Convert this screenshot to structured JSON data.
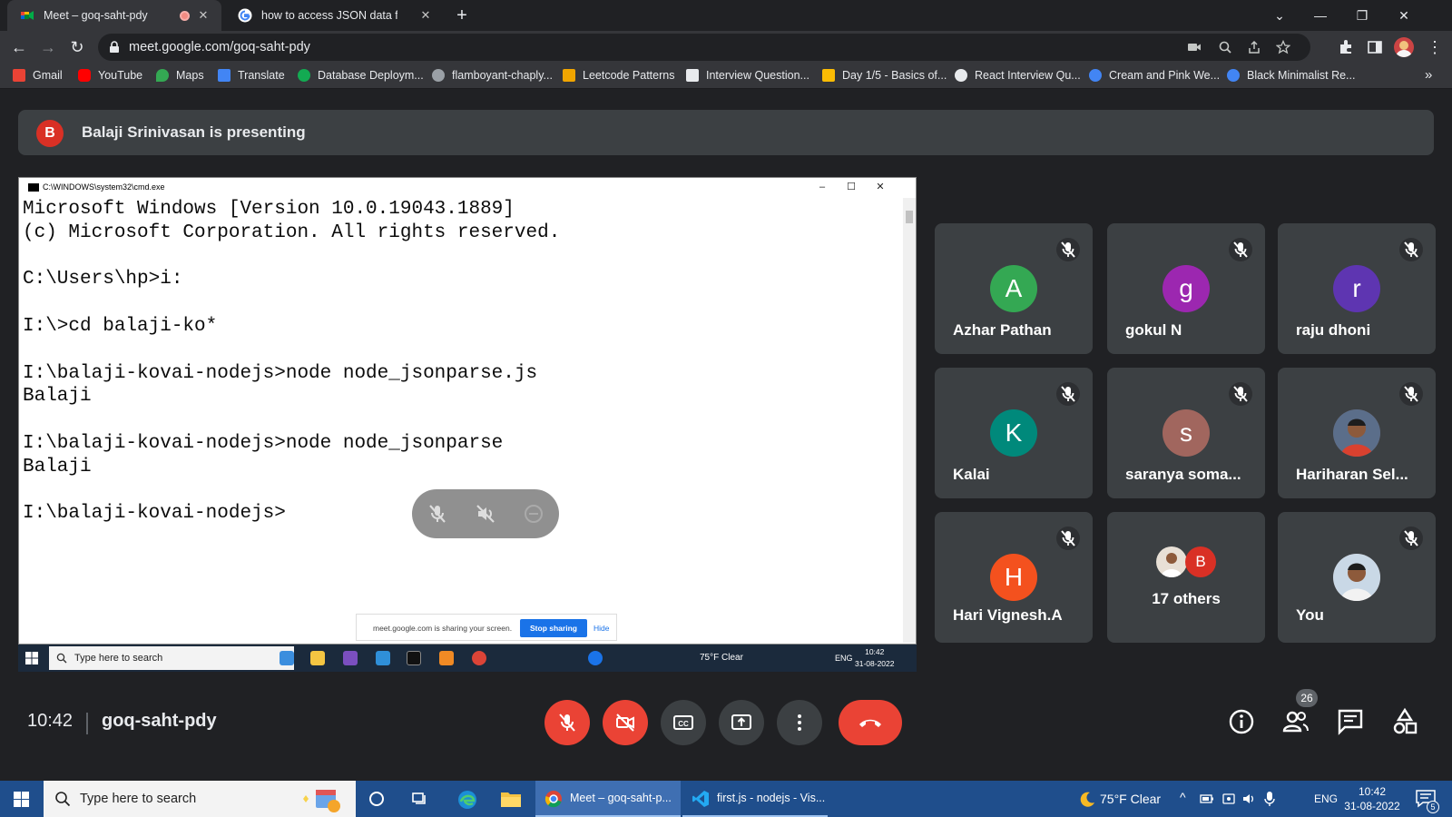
{
  "browser": {
    "tabs": [
      {
        "label": "Meet – goq-saht-pdy"
      },
      {
        "label": "how to access JSON data from n"
      }
    ],
    "url": "meet.google.com/goq-saht-pdy",
    "bookmarks": [
      {
        "label": "Gmail",
        "color": "#ea4335"
      },
      {
        "label": "YouTube",
        "color": "#ff0000"
      },
      {
        "label": "Maps",
        "color": "#34a853"
      },
      {
        "label": "Translate",
        "color": "#4285f4"
      },
      {
        "label": "Database Deploym...",
        "color": "#13aa52"
      },
      {
        "label": "flamboyant-chaply...",
        "color": "#9aa0a6"
      },
      {
        "label": "Leetcode Patterns",
        "color": "#f0a500"
      },
      {
        "label": "Interview Question...",
        "color": "#e8eaed"
      },
      {
        "label": "Day 1/5 - Basics of...",
        "color": "#fbbc04"
      },
      {
        "label": "React Interview Qu...",
        "color": "#e8eaed"
      },
      {
        "label": "Cream and Pink We...",
        "color": "#4285f4"
      },
      {
        "label": "Black Minimalist Re...",
        "color": "#4285f4"
      }
    ]
  },
  "meet": {
    "presenter": {
      "initial": "B",
      "text": "Balaji Srinivasan is presenting"
    },
    "shared_screen": {
      "window_title": "C:\\WINDOWS\\system32\\cmd.exe",
      "lines": [
        "Microsoft Windows [Version 10.0.19043.1889]",
        "(c) Microsoft Corporation. All rights reserved.",
        "",
        "C:\\Users\\hp>i:",
        "",
        "I:\\>cd balaji-ko*",
        "",
        "I:\\balaji-kovai-nodejs>node node_jsonparse.js",
        "Balaji",
        "",
        "I:\\balaji-kovai-nodejs>node node_jsonparse",
        "Balaji",
        "",
        "I:\\balaji-kovai-nodejs>"
      ],
      "share_notice": "meet.google.com is sharing your screen.",
      "stop_sharing": "Stop sharing",
      "hide": "Hide",
      "taskbar": {
        "search": "Type here to search",
        "weather": "75°F  Clear",
        "lang": "ENG",
        "time": "10:42",
        "date": "31-08-2022"
      }
    },
    "participants": [
      {
        "name": "Azhar Pathan",
        "initial": "A",
        "color": "#34a853"
      },
      {
        "name": "gokul N",
        "initial": "g",
        "color": "#9c27b0"
      },
      {
        "name": "raju dhoni",
        "initial": "r",
        "color": "#5e35b1"
      },
      {
        "name": "Kalai",
        "initial": "K",
        "color": "#00897b"
      },
      {
        "name": "saranya soma...",
        "initial": "s",
        "color": "#a1665e"
      },
      {
        "name": "Hariharan Sel...",
        "initial": "",
        "color": "#6d4c41"
      },
      {
        "name": "Hari Vignesh.A",
        "initial": "H",
        "color": "#f4511e"
      },
      {
        "name": "17 others",
        "initial": "B",
        "color": "#d93025"
      },
      {
        "name": "You",
        "initial": "",
        "color": "#8d6e63"
      }
    ],
    "time": "10:42",
    "meeting_code": "goq-saht-pdy",
    "people_count": "26"
  },
  "taskbar": {
    "search": "Type here to search",
    "apps": [
      {
        "label": "Meet – goq-saht-p..."
      },
      {
        "label": "first.js - nodejs - Vis..."
      }
    ],
    "weather": "75°F  Clear",
    "lang": "ENG",
    "time": "10:42",
    "date": "31-08-2022",
    "notifications": "5"
  }
}
